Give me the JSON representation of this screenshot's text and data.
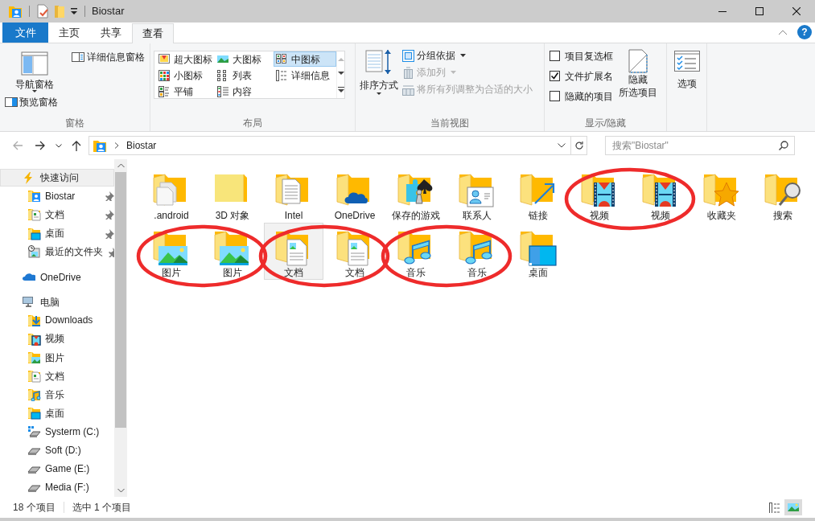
{
  "window": {
    "title": "Biostar"
  },
  "ribbon_tabs": [
    {
      "label": "文件",
      "kind": "file",
      "selected": false
    },
    {
      "label": "主页",
      "kind": "tab",
      "selected": false
    },
    {
      "label": "共享",
      "kind": "tab",
      "selected": false
    },
    {
      "label": "查看",
      "kind": "tab",
      "selected": true
    }
  ],
  "panes_group": {
    "label": "窗格",
    "navigation_pane": "导航窗格",
    "preview_pane": "预览窗格",
    "details_pane": "详细信息窗格"
  },
  "layout_group": {
    "label": "布局",
    "options": [
      {
        "label": "超大图标",
        "kind": "xl",
        "selected": false
      },
      {
        "label": "大图标",
        "kind": "large",
        "selected": false
      },
      {
        "label": "中图标",
        "kind": "medium",
        "selected": true
      },
      {
        "label": "小图标",
        "kind": "small",
        "selected": false
      },
      {
        "label": "列表",
        "kind": "list",
        "selected": false
      },
      {
        "label": "详细信息",
        "kind": "details",
        "selected": false
      },
      {
        "label": "平铺",
        "kind": "tiles",
        "selected": false
      },
      {
        "label": "内容",
        "kind": "content",
        "selected": false
      }
    ]
  },
  "current_view_group": {
    "label": "当前视图",
    "sort": "排序方式",
    "commands": [
      {
        "label": "分组依据",
        "kind": "group",
        "disabled": false
      },
      {
        "label": "添加列",
        "kind": "addcol",
        "disabled": true
      },
      {
        "label": "将所有列调整为合适的大小",
        "kind": "fit",
        "disabled": true
      }
    ]
  },
  "show_hide_group": {
    "label": "显示/隐藏",
    "checkboxes": [
      {
        "label": "项目复选框",
        "checked": false
      },
      {
        "label": "文件扩展名",
        "checked": true
      },
      {
        "label": "隐藏的项目",
        "checked": false
      }
    ],
    "hide_selected": [
      "隐藏",
      "所选项目"
    ]
  },
  "options_button": "选项",
  "help_button": "?",
  "address_bar": {
    "path": "Biostar"
  },
  "search": {
    "placeholder": "搜索\"Biostar\""
  },
  "navigation": [
    {
      "label": "快速访问",
      "kind": "quick",
      "selected": true,
      "children": [
        {
          "label": "Biostar",
          "kind": "user",
          "pinned": true
        },
        {
          "label": "文档",
          "kind": "docs",
          "pinned": true
        },
        {
          "label": "桌面",
          "kind": "desktop",
          "pinned": true
        },
        {
          "label": "最近的文件夹",
          "kind": "recent",
          "pinned": true
        }
      ]
    },
    {
      "label": "OneDrive",
      "kind": "onedrive",
      "selected": false
    },
    {
      "label": "电脑",
      "kind": "pc",
      "selected": false,
      "children": [
        {
          "label": "Downloads",
          "kind": "downloads",
          "pinned": false
        },
        {
          "label": "视频",
          "kind": "video",
          "pinned": false
        },
        {
          "label": "图片",
          "kind": "pictures",
          "pinned": false
        },
        {
          "label": "文档",
          "kind": "docs",
          "pinned": false
        },
        {
          "label": "音乐",
          "kind": "music",
          "pinned": false
        },
        {
          "label": "桌面",
          "kind": "desktop",
          "pinned": false
        },
        {
          "label": "Systerm (C:)",
          "kind": "sysdrive",
          "pinned": false
        },
        {
          "label": "Soft (D:)",
          "kind": "drive",
          "pinned": false
        },
        {
          "label": "Game (E:)",
          "kind": "drive",
          "pinned": false
        },
        {
          "label": "Media (F:)",
          "kind": "drive",
          "pinned": false
        }
      ]
    }
  ],
  "items": [
    {
      "label": ".android",
      "kind": "file",
      "selected": false
    },
    {
      "label": "3D 对象",
      "kind": "plain",
      "selected": false
    },
    {
      "label": "Intel",
      "kind": "docpage",
      "selected": false
    },
    {
      "label": "OneDrive",
      "kind": "onedrive",
      "selected": false
    },
    {
      "label": "保存的游戏",
      "kind": "games",
      "selected": false
    },
    {
      "label": "联系人",
      "kind": "contact",
      "selected": false
    },
    {
      "label": "链接",
      "kind": "link",
      "selected": false
    },
    {
      "label": "视频",
      "kind": "video",
      "selected": false,
      "circled": true
    },
    {
      "label": "视频",
      "kind": "video",
      "selected": false,
      "circled": true
    },
    {
      "label": "收藏夹",
      "kind": "favorites",
      "selected": false
    },
    {
      "label": "搜索",
      "kind": "search",
      "selected": false
    },
    {
      "label": "图片",
      "kind": "pictures",
      "selected": false,
      "circled": true
    },
    {
      "label": "图片",
      "kind": "pictures",
      "selected": false,
      "circled": true
    },
    {
      "label": "文档",
      "kind": "docs",
      "selected": true,
      "circled": true
    },
    {
      "label": "文档",
      "kind": "docs",
      "selected": false,
      "circled": true
    },
    {
      "label": "音乐",
      "kind": "music",
      "selected": false,
      "circled": true
    },
    {
      "label": "音乐",
      "kind": "music",
      "selected": false,
      "circled": true
    },
    {
      "label": "桌面",
      "kind": "desktop",
      "selected": false
    }
  ],
  "status_bar": {
    "item_count": "18 个项目",
    "selection": "选中 1 个项目"
  }
}
